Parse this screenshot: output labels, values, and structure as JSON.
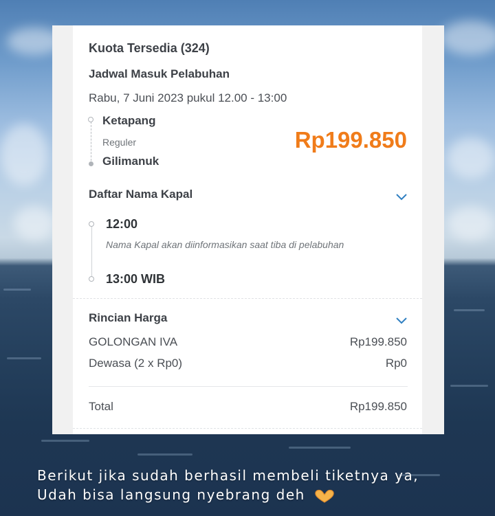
{
  "ticket": {
    "quota": "Kuota Tersedia (324)",
    "schedule_title": "Jadwal Masuk Pelabuhan",
    "schedule_date": "Rabu, 7 Juni 2023 pukul 12.00 - 13:00",
    "origin": "Ketapang",
    "service": "Reguler",
    "destination": "Gilimanuk",
    "price": "Rp199.850"
  },
  "ships": {
    "title": "Daftar Nama Kapal",
    "start_time": "12:00",
    "note": "Nama Kapal akan diinformasikan saat tiba di pelabuhan",
    "end_time": "13:00 WIB"
  },
  "pricing": {
    "title": "Rincian Harga",
    "rows": [
      {
        "label": "GOLONGAN IVA",
        "value": "Rp199.850"
      },
      {
        "label": "Dewasa (2 x Rp0)",
        "value": "Rp0"
      }
    ],
    "total_label": "Total",
    "total_value": "Rp199.850"
  },
  "caption": {
    "line1": "Berikut jika sudah berhasil membeli tiketnya ya,",
    "line2": "Udah bisa langsung nyebrang deh"
  },
  "colors": {
    "price": "#f07c1a",
    "chevron": "#2f7fc1"
  },
  "icons": [
    "chevron-down-icon",
    "heart-hands-icon"
  ]
}
